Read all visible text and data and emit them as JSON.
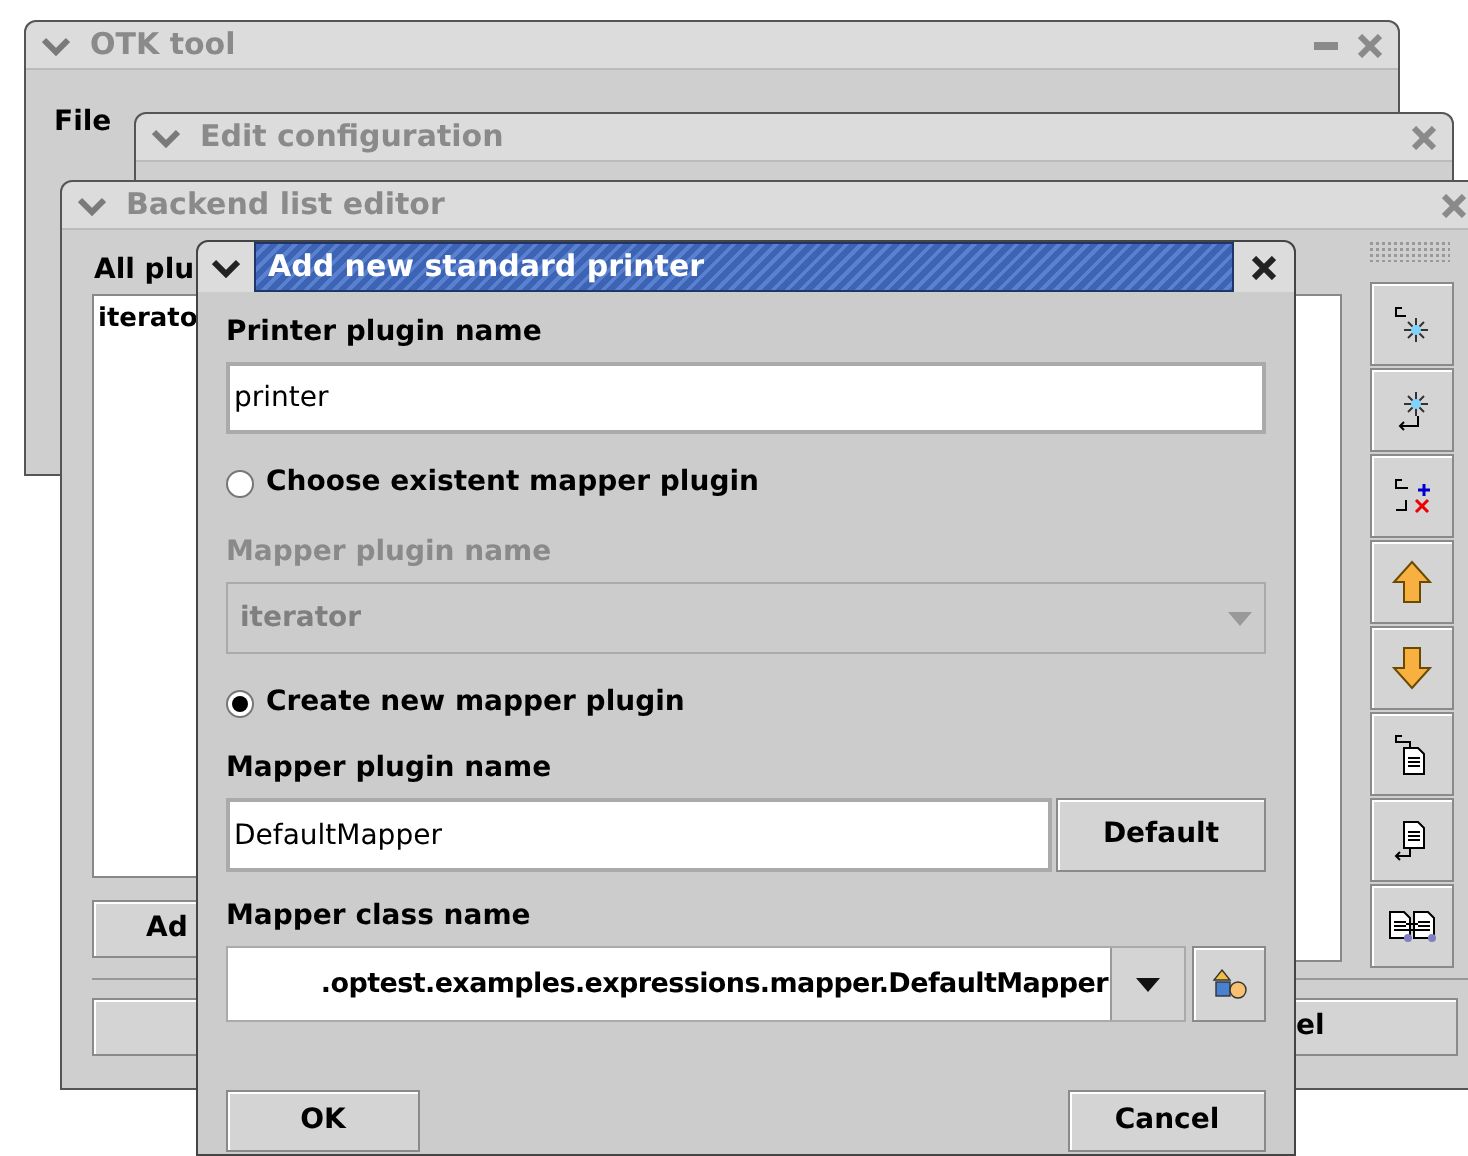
{
  "main_window": {
    "title": "OTK tool",
    "menu": [
      "File"
    ]
  },
  "config_window": {
    "title": "Edit configuration"
  },
  "backend_window": {
    "title": "Backend list editor",
    "list_label": "All plu",
    "list_items": [
      {
        "label": "iterato",
        "selected": false
      }
    ],
    "add_button": "Ad",
    "cancel_button": "el",
    "toolbar": [
      {
        "kind": "insert-before"
      },
      {
        "kind": "insert-after"
      },
      {
        "kind": "replace"
      },
      {
        "kind": "up"
      },
      {
        "kind": "down"
      },
      {
        "kind": "doc-before"
      },
      {
        "kind": "doc-after"
      },
      {
        "kind": "swap"
      }
    ]
  },
  "dialog": {
    "title": "Add new standard printer",
    "printer_label": "Printer plugin name",
    "printer_value": "printer",
    "options": [
      {
        "label": "Choose existent mapper plugin",
        "selected": false
      },
      {
        "label": "Create new mapper plugin",
        "selected": true
      }
    ],
    "existing_label": "Mapper plugin name",
    "existing_value": "iterator",
    "existing_disabled": true,
    "new_label": "Mapper plugin name",
    "new_value": "DefaultMapper",
    "default_button": "Default",
    "class_label": "Mapper class name",
    "class_value": ".optest.examples.expressions.mapper.DefaultMapper",
    "ok_button": "OK",
    "cancel_button": "Cancel"
  }
}
